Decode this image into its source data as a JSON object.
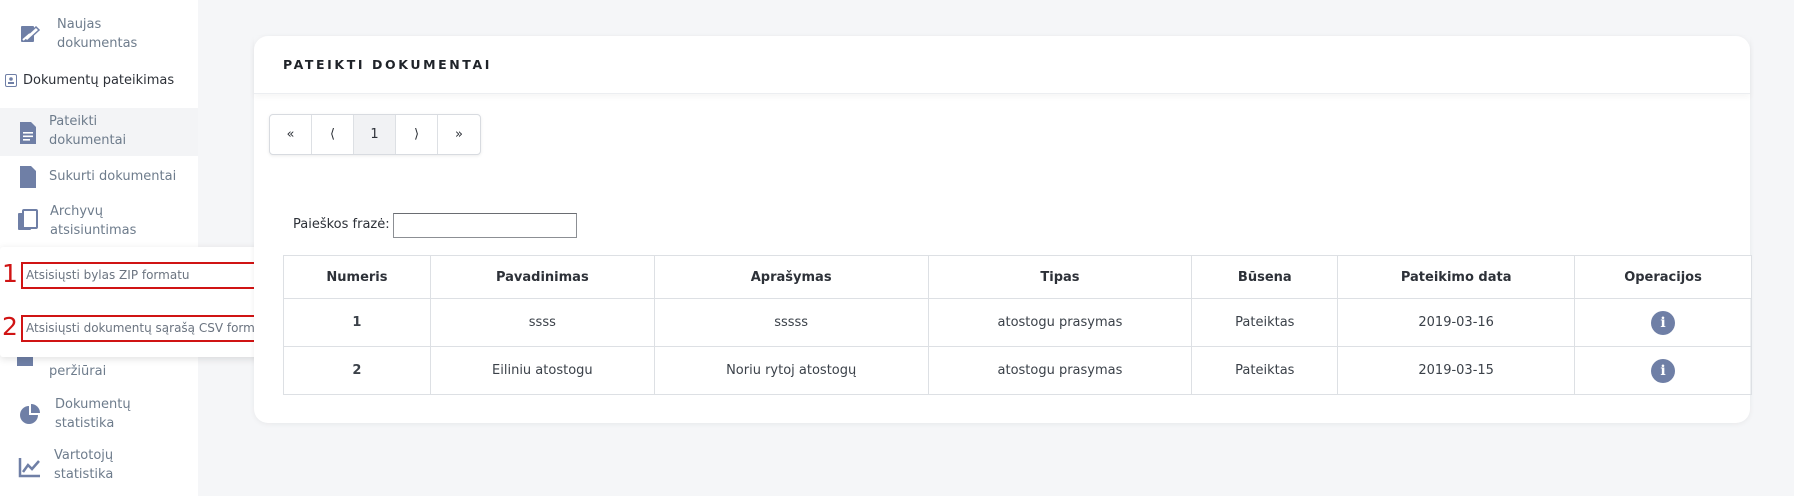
{
  "sidebar": {
    "items": [
      {
        "label": "Naujas dokumentas",
        "icon": "edit-document-icon"
      },
      {
        "label": "Pateikti dokumentai",
        "icon": "document-icon"
      },
      {
        "label": "Sukurti dokumentai",
        "icon": "document-icon"
      },
      {
        "label": "Archyvų atsisiuntimas",
        "icon": "copy-icon"
      },
      {
        "label": "peržiūrai",
        "icon": "document-icon"
      },
      {
        "label": "Dokumentų statistika",
        "icon": "pie-chart-icon"
      },
      {
        "label": "Vartotojų statistika",
        "icon": "line-chart-icon"
      }
    ],
    "section": {
      "label": "Dokumentų pateikimas",
      "icon": "id-card-icon"
    }
  },
  "popup": {
    "items": [
      {
        "number": "1",
        "label": "Atsisiųsti bylas ZIP formatu"
      },
      {
        "number": "2",
        "label": "Atsisiųsti dokumentų sąrašą CSV formatu"
      }
    ]
  },
  "card": {
    "title": "PATEIKTI DOKUMENTAI",
    "pager": {
      "first": "«",
      "prev": "⟨",
      "current": "1",
      "next": "⟩",
      "last": "»"
    },
    "search": {
      "label": "Paieškos frazė:",
      "value": ""
    },
    "table": {
      "headers": [
        "Numeris",
        "Pavadinimas",
        "Aprašymas",
        "Tipas",
        "Būsena",
        "Pateikimo data",
        "Operacijos"
      ],
      "rows": [
        {
          "numeris": "1",
          "pavadinimas": "ssss",
          "aprasymas": "sssss",
          "tipas": "atostogu prasymas",
          "busena": "Pateiktas",
          "data": "2019-03-16"
        },
        {
          "numeris": "2",
          "pavadinimas": "Eiliniu atostogu",
          "aprasymas": "Noriu rytoj atostogų",
          "tipas": "atostogu prasymas",
          "busena": "Pateiktas",
          "data": "2019-03-15"
        }
      ]
    }
  },
  "colors": {
    "icon": "#6f7fa6",
    "highlight": "#d01414",
    "background": "#f5f6f8"
  }
}
